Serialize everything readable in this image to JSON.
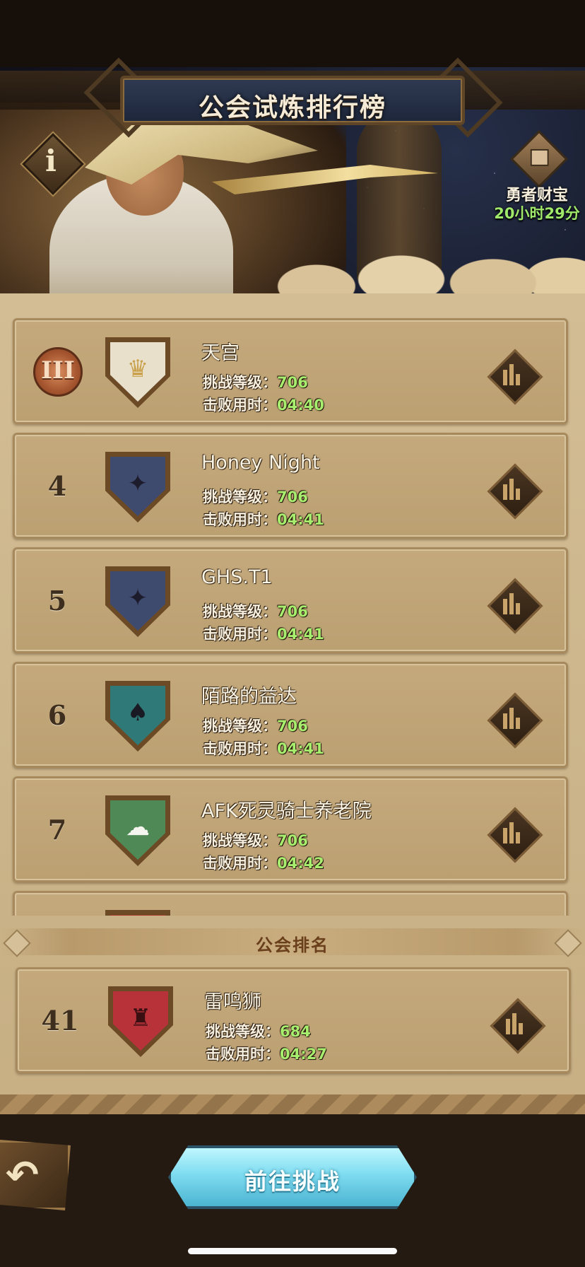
{
  "header": {
    "title": "公会试炼排行榜",
    "info_glyph": "i"
  },
  "treasure": {
    "label": "勇者财宝",
    "timer": "20小时29分"
  },
  "stat_labels": {
    "level": "挑战等级：",
    "time": "击败用时："
  },
  "rows": [
    {
      "rank": "III",
      "name": "天宫",
      "level": "706",
      "time": "04:40",
      "crest_color": "#e9e0cc",
      "crest_icon": "♛"
    },
    {
      "rank": "4",
      "name": "Honey Night",
      "level": "706",
      "time": "04:41",
      "crest_color": "#3e4b6e",
      "crest_icon": "✦"
    },
    {
      "rank": "5",
      "name": "GHS.T1",
      "level": "706",
      "time": "04:41",
      "crest_color": "#3e4b6e",
      "crest_icon": "✦"
    },
    {
      "rank": "6",
      "name": "陌路的益达",
      "level": "706",
      "time": "04:41",
      "crest_color": "#2f7a78",
      "crest_icon": "♠"
    },
    {
      "rank": "7",
      "name": "AFK死灵骑士养老院",
      "level": "706",
      "time": "04:42",
      "crest_color": "#4f8a56",
      "crest_icon": "☁"
    },
    {
      "rank": "",
      "name": "",
      "level": "",
      "time": "",
      "crest_color": "#a5392a",
      "crest_icon": ""
    }
  ],
  "guild_rank": {
    "section_title": "公会排名",
    "rank": "41",
    "name": "雷鸣狮",
    "level": "684",
    "time": "04:27",
    "crest_color": "#b8323a",
    "crest_icon": "♜"
  },
  "footer": {
    "back_glyph": "↶",
    "go_label": "前往挑战"
  }
}
